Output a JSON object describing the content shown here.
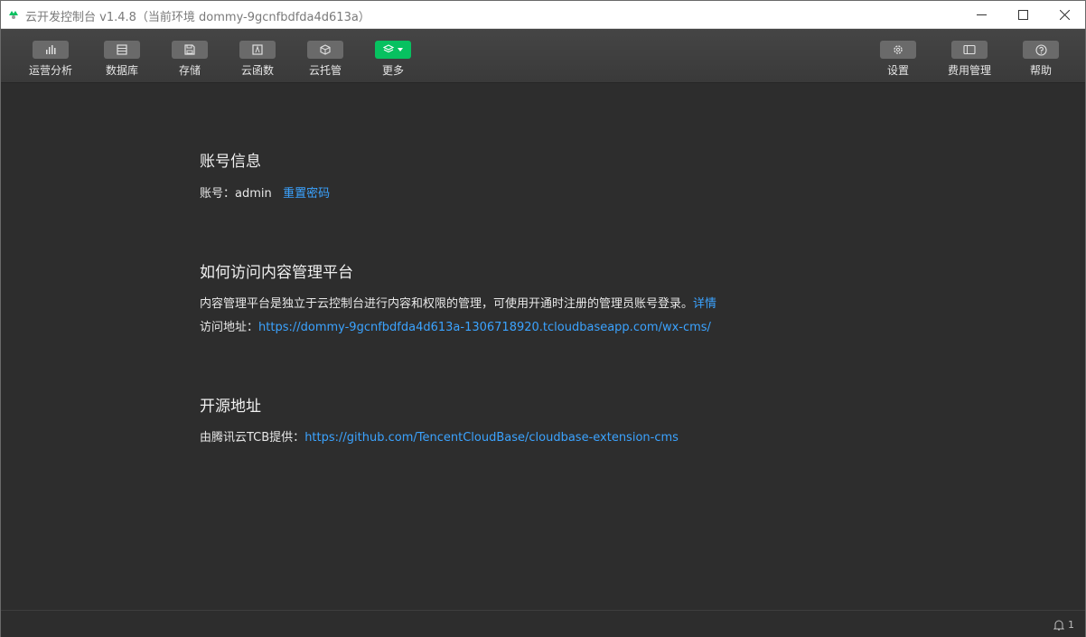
{
  "window": {
    "title": "云开发控制台 v1.4.8（当前环境 dommy-9gcnfbdfda4d613a）"
  },
  "toolbar": {
    "items": [
      {
        "label": "运营分析",
        "icon": "bar-chart-icon"
      },
      {
        "label": "数据库",
        "icon": "database-icon"
      },
      {
        "label": "存储",
        "icon": "storage-icon"
      },
      {
        "label": "云函数",
        "icon": "function-icon"
      },
      {
        "label": "云托管",
        "icon": "cube-icon"
      },
      {
        "label": "更多",
        "icon": "layers-icon"
      }
    ],
    "right_items": [
      {
        "label": "设置",
        "icon": "gear-icon"
      },
      {
        "label": "费用管理",
        "icon": "billing-icon"
      },
      {
        "label": "帮助",
        "icon": "help-icon"
      }
    ]
  },
  "account": {
    "title": "账号信息",
    "label": "账号：",
    "username": "admin",
    "reset_link": "重置密码"
  },
  "access": {
    "title": "如何访问内容管理平台",
    "description": "内容管理平台是独立于云控制台进行内容和权限的管理，可使用开通时注册的管理员账号登录。",
    "details_link": "详情",
    "url_label": "访问地址：",
    "url": "https://dommy-9gcnfbdfda4d613a-1306718920.tcloudbaseapp.com/wx-cms/"
  },
  "opensource": {
    "title": "开源地址",
    "label": "由腾讯云TCB提供：",
    "url": "https://github.com/TencentCloudBase/cloudbase-extension-cms"
  },
  "statusbar": {
    "notification_count": "1"
  },
  "colors": {
    "accent": "#07c160",
    "link": "#3ba3ff",
    "background": "#2d2d2d"
  }
}
